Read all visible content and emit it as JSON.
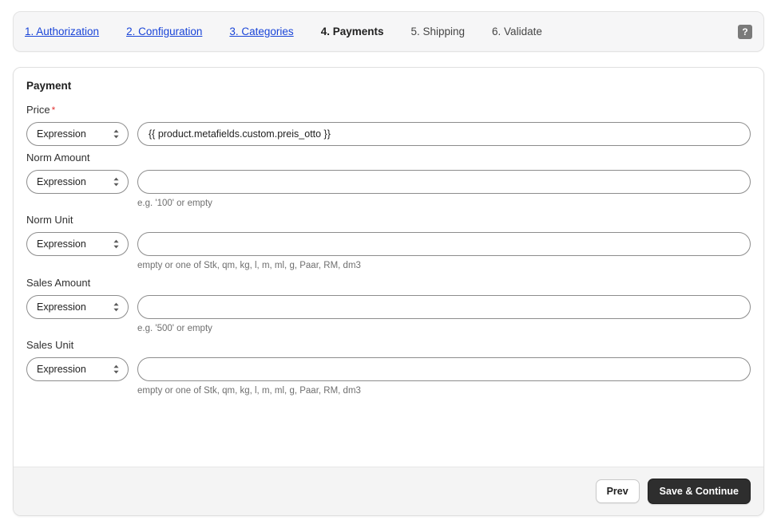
{
  "stepnav": {
    "steps": [
      {
        "label": "1. Authorization",
        "state": "link"
      },
      {
        "label": "2. Configuration",
        "state": "link"
      },
      {
        "label": "3. Categories",
        "state": "link"
      },
      {
        "label": "4. Payments",
        "state": "current"
      },
      {
        "label": "5. Shipping",
        "state": "plain"
      },
      {
        "label": "6. Validate",
        "state": "plain"
      }
    ],
    "help_label": "?"
  },
  "form": {
    "section_title": "Payment",
    "required_marker": "*",
    "fields": [
      {
        "label": "Price",
        "required": true,
        "mode": "Expression",
        "value": "{{ product.metafields.custom.preis_otto }}",
        "placeholder": "",
        "hint": ""
      },
      {
        "label": "Norm Amount",
        "required": false,
        "mode": "Expression",
        "value": "",
        "placeholder": "",
        "hint": "e.g. '100' or empty"
      },
      {
        "label": "Norm Unit",
        "required": false,
        "mode": "Expression",
        "value": "",
        "placeholder": "",
        "hint": "empty or one of Stk, qm, kg, l, m, ml, g, Paar, RM, dm3"
      },
      {
        "label": "Sales Amount",
        "required": false,
        "mode": "Expression",
        "value": "",
        "placeholder": "",
        "hint": "e.g. '500' or empty"
      },
      {
        "label": "Sales Unit",
        "required": false,
        "mode": "Expression",
        "value": "",
        "placeholder": "",
        "hint": "empty or one of Stk, qm, kg, l, m, ml, g, Paar, RM, dm3"
      }
    ]
  },
  "footer": {
    "prev_label": "Prev",
    "save_label": "Save & Continue"
  },
  "colors": {
    "link": "#1a45d8",
    "required": "#e23535",
    "primary_button": "#2e2e2e",
    "help_badge": "#7a7a7a"
  }
}
